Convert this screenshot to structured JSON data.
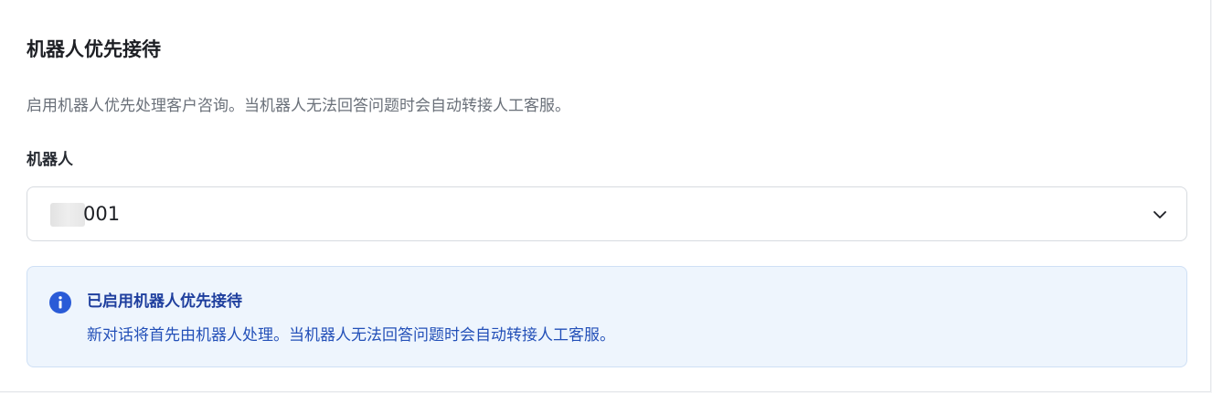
{
  "section": {
    "title": "机器人优先接待",
    "description": "启用机器人优先处理客户咨询。当机器人无法回答问题时会自动转接人工客服。"
  },
  "robot_field": {
    "label": "机器人",
    "selected_value": "001",
    "chevron_icon": "chevron-down-icon"
  },
  "alert": {
    "icon": "info-icon",
    "title": "已启用机器人优先接待",
    "text": "新对话将首先由机器人处理。当机器人无法回答问题时会自动转接人工客服。",
    "colors": {
      "background": "#eef5fd",
      "border": "#cfe0f5",
      "accent": "#2a5bd7"
    }
  }
}
